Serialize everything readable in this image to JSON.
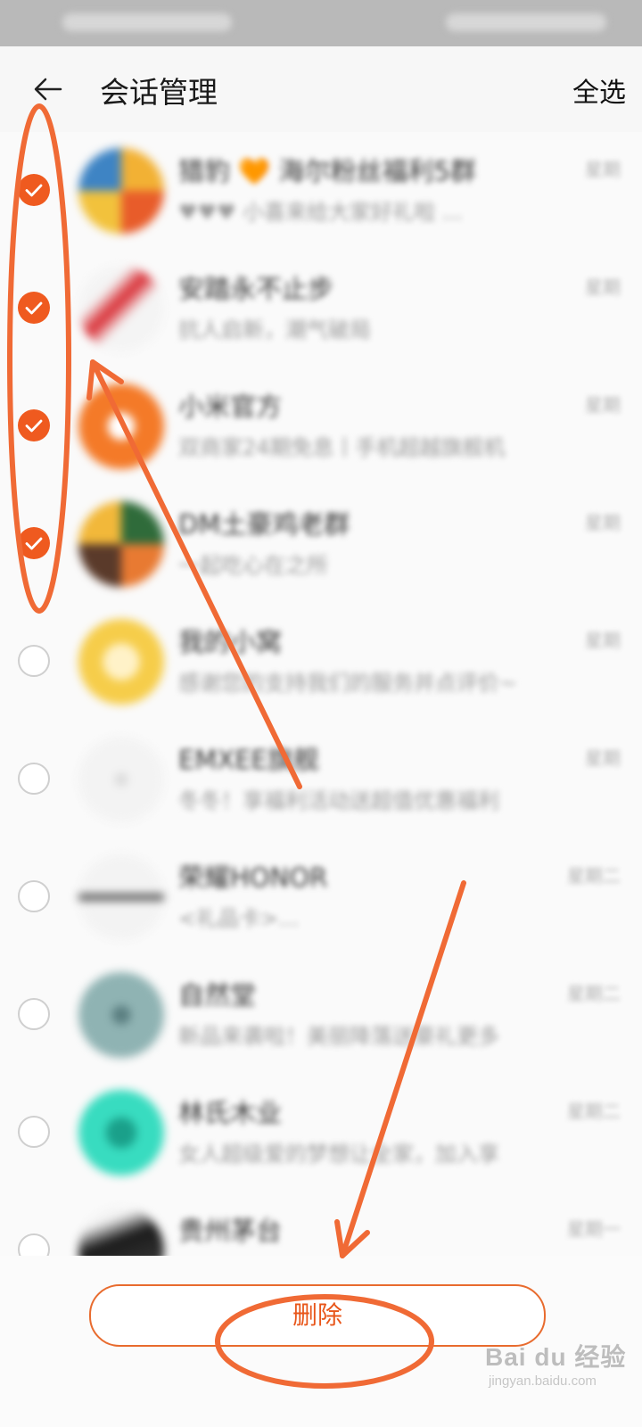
{
  "header": {
    "title": "会话管理",
    "select_all": "全选"
  },
  "conversations": [
    {
      "name": "猎豹 🧡 海尔粉丝福利5群",
      "preview": "♥♥♥ 小喜来给大家好礼啦 ...",
      "time": "星期",
      "checked": true
    },
    {
      "name": "安踏永不止步",
      "preview": "抗人启新，潮气破局",
      "time": "星期",
      "checked": true
    },
    {
      "name": "小米官方",
      "preview": "双商家24期免息丨手机超越旗舰机",
      "time": "星期",
      "checked": true
    },
    {
      "name": "DM土豪鸡老群",
      "preview": "一起吃心在之所",
      "time": "星期",
      "checked": true
    },
    {
      "name": "我的小窝",
      "preview": "感谢您的支持我们的服务并点评价~",
      "time": "星期",
      "checked": false
    },
    {
      "name": "EMXEE旗舰",
      "preview": "冬冬！享福利活动送超值优惠福利",
      "time": "星期",
      "checked": false
    },
    {
      "name": "荣耀HONOR",
      "preview": "<礼品卡>...",
      "time": "星期二",
      "checked": false
    },
    {
      "name": "自然堂",
      "preview": "新品来袭啦！美丽降落送豪礼更多",
      "time": "星期二",
      "checked": false
    },
    {
      "name": "林氏木业",
      "preview": "女人超级爱的梦想让全家，加入享",
      "time": "星期二",
      "checked": false
    },
    {
      "name": "贵州茅台",
      "preview": "----- ----- -----",
      "time": "星期一",
      "checked": false
    }
  ],
  "bottom": {
    "delete_label": "删除"
  },
  "watermark": {
    "main": "Bai du 经验",
    "sub": "jingyan.baidu.com"
  },
  "colors": {
    "accent": "#ef5a1f",
    "annotation": "#f06a35"
  }
}
